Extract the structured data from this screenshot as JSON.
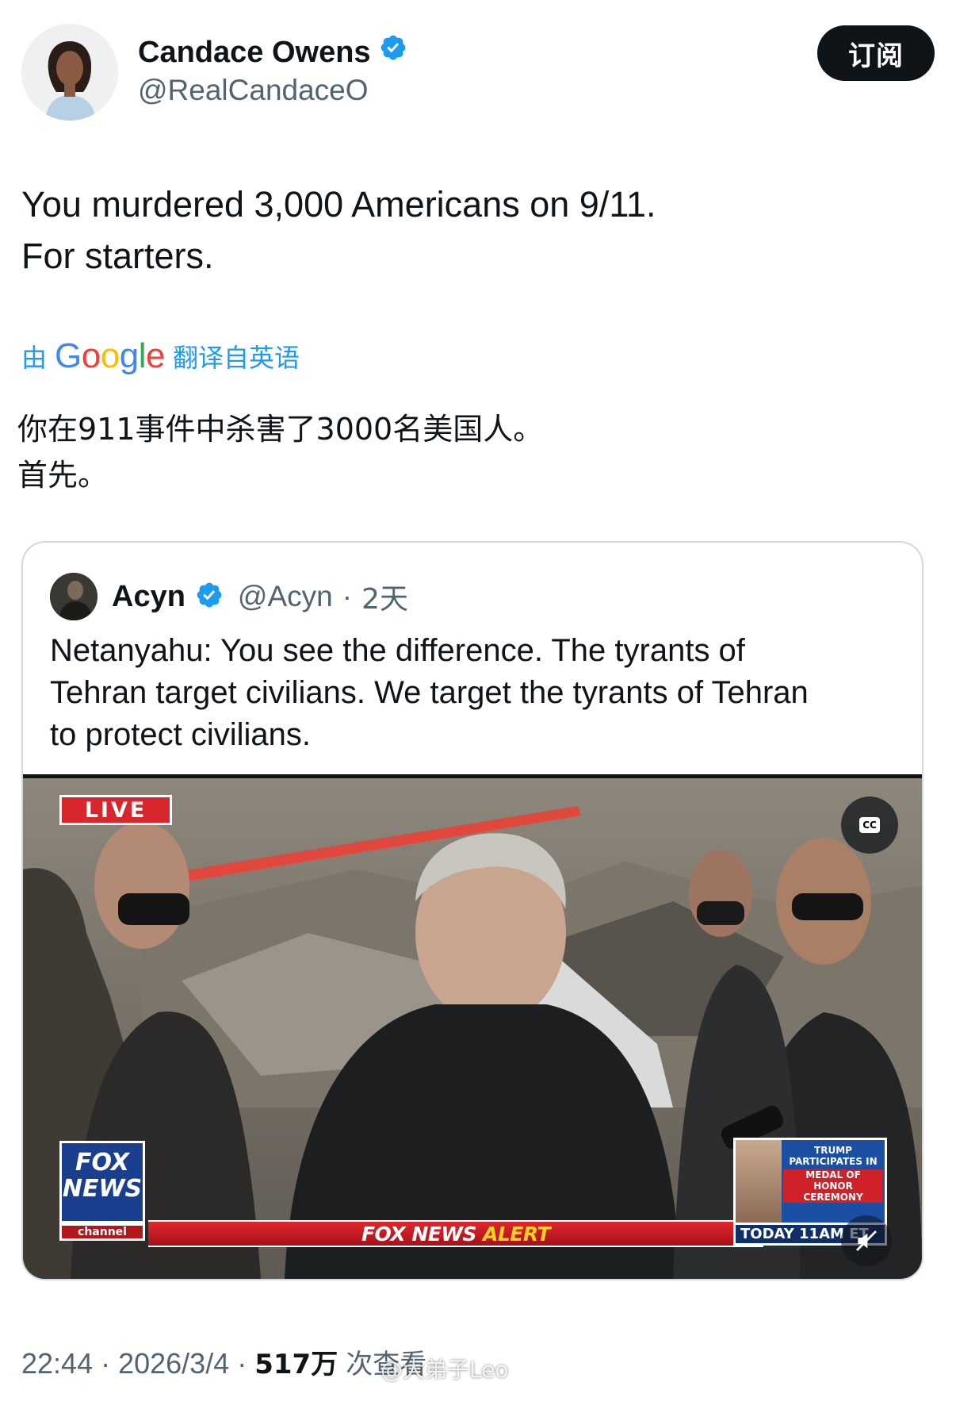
{
  "author": {
    "name": "Candace Owens",
    "handle": "@RealCandaceO",
    "verified_icon": "verified-badge-icon",
    "subscribe_label": "订阅"
  },
  "tweet": {
    "lines": [
      "You murdered 3,000 Americans on 9/11.",
      "For starters."
    ]
  },
  "translation": {
    "prefix": "由",
    "google": [
      "G",
      "o",
      "o",
      "g",
      "l",
      "e"
    ],
    "suffix": "翻译自英语",
    "lines": [
      "你在911事件中杀害了3000名美国人。",
      "首先。"
    ]
  },
  "quoted": {
    "name": "Acyn",
    "handle": "@Acyn",
    "separator": "·",
    "time": "2天",
    "lines": [
      "Netanyahu: You see the difference. The tyrants of",
      "Tehran target civilians. We target the tyrants of Tehran",
      "to protect civilians."
    ],
    "video": {
      "live_label": "LIVE",
      "cc_label": "CC",
      "logo_line1": "FOX",
      "logo_line2": "NEWS",
      "logo_channel": "channel",
      "alert_brand": "FOX NEWS",
      "alert_word": "ALERT",
      "promo_line1": "TRUMP",
      "promo_line2": "PARTICIPATES IN",
      "promo_line3": "MEDAL OF HONOR",
      "promo_line4": "CEREMONY",
      "promo_time": "TODAY 11AM ET"
    }
  },
  "meta": {
    "time": "22:44",
    "dot": "·",
    "date": "2026/3/4",
    "views_num": "517万",
    "views_label": "次查看"
  },
  "watermark": "@大弟子Leo",
  "colors": {
    "accent_blue": "#1d9bf0",
    "text_primary": "#0f1419",
    "text_secondary": "#536471",
    "border": "#cfd9de",
    "fox_red": "#d8262d"
  }
}
